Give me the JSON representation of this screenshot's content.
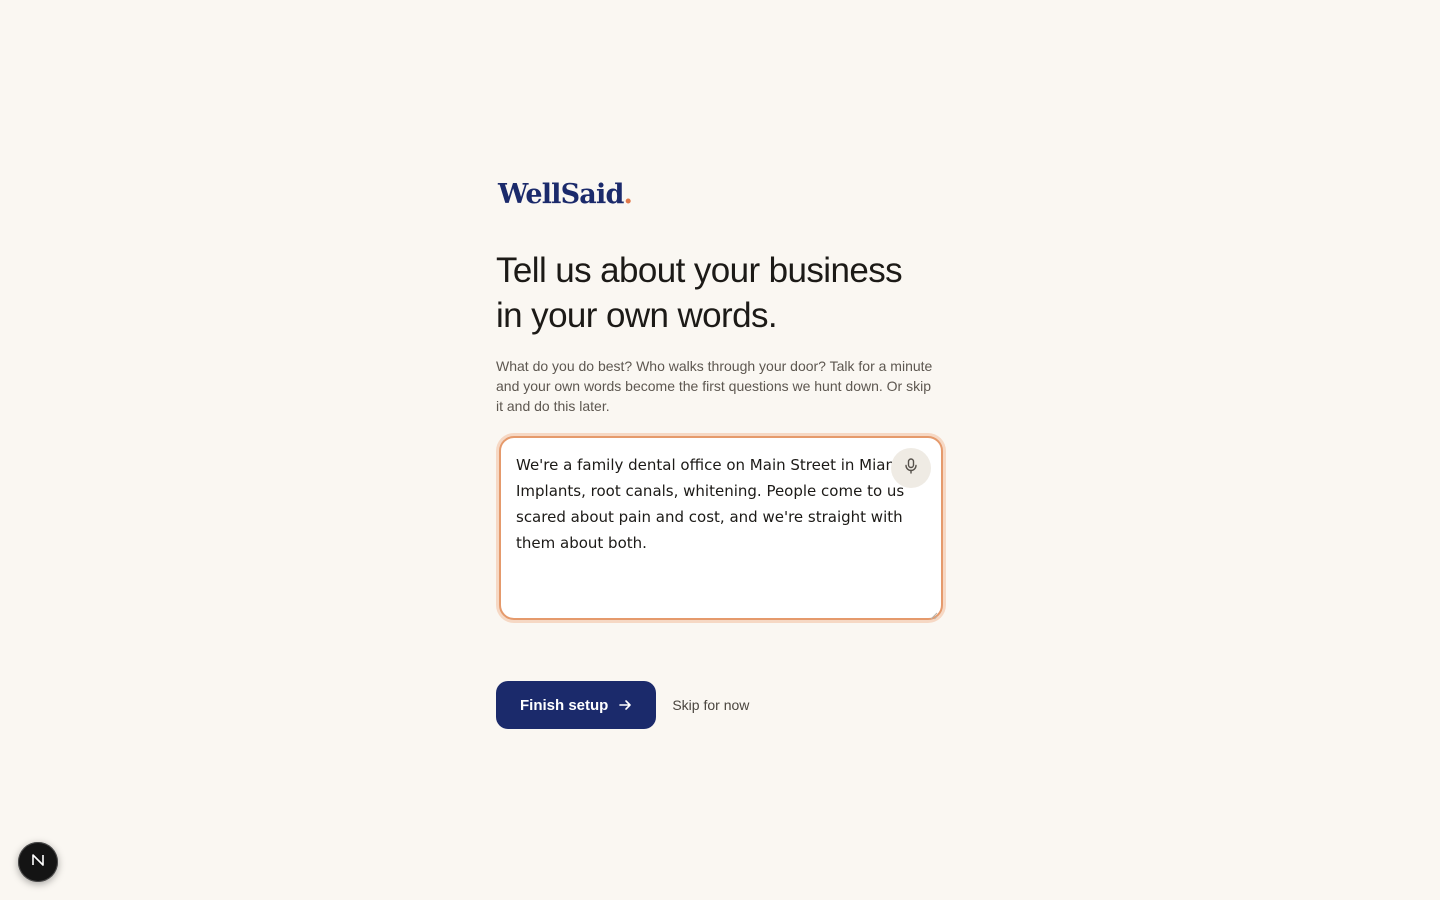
{
  "brand": {
    "name": "WellSaid",
    "dot": ".",
    "navy": "#1b2a6b",
    "accent": "#e0784a"
  },
  "onboarding": {
    "headline_lines": [
      "Tell us about your business",
      "in your own words."
    ],
    "lede_lines": [
      "What do you do best? Who walks through your door? Talk for a minute",
      "and your own words become the first questions we hunt down. Or skip",
      "it and do this later."
    ],
    "answer_lines": [
      "We're a family dental office on Main Street in Miami.",
      "Implants, root canals, whitening. People come to us",
      "scared about pain and cost, and we're straight with",
      "them about both."
    ],
    "mic_icon": "microphone-icon"
  },
  "actions": {
    "finish_label": "Finish setup",
    "finish_icon": "arrow-right-icon",
    "skip_label": "Skip for now"
  },
  "dev_badge": {
    "letter": "N"
  }
}
